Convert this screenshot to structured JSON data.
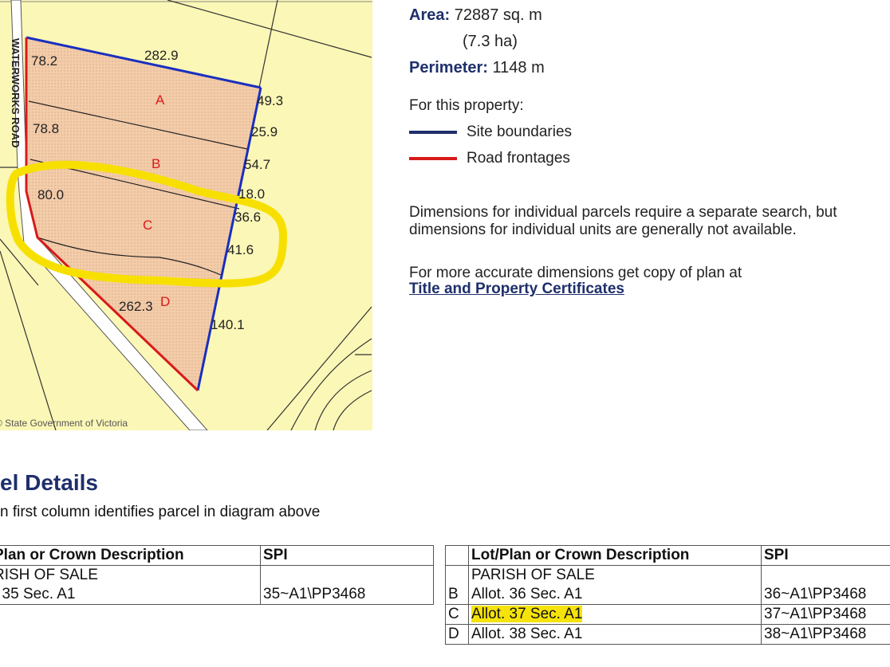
{
  "map": {
    "road_label": "WATERWORKS ROAD",
    "copyright": "© State Government of Victoria",
    "parcel_labels": [
      "A",
      "B",
      "C",
      "D"
    ],
    "dimensions": [
      "282.9",
      "78.2",
      "78.8",
      "80.0",
      "49.3",
      "25.9",
      "54.7",
      "18.0",
      "36.6",
      "41.6",
      "262.3",
      "140.1"
    ],
    "colors": {
      "site_boundary": "#1a2fbf",
      "road_frontage": "#d81a1a",
      "highlight": "#f7e000"
    }
  },
  "info": {
    "area_label": "Area:",
    "area_value": "72887 sq. m",
    "area_ha": "(7.3 ha)",
    "perimeter_label": "Perimeter:",
    "perimeter_value": "1148 m",
    "legend_title": "For this property:",
    "legend_site": "Site boundaries",
    "legend_road": "Road frontages",
    "note1_line1": "Dimensions for individual parcels require a separate search, but",
    "note1_line2": "dimensions for individual units are generally not available.",
    "note2": "For more accurate dimensions get copy of plan at",
    "link": "Title and Property Certificates"
  },
  "details": {
    "title": "el Details",
    "subtitle": "n first column identifies parcel in diagram above",
    "table_left": {
      "headers": [
        "Plan or Crown Description",
        "SPI"
      ],
      "rows": [
        {
          "desc_1": "RISH OF SALE",
          "desc_2": ". 35 Sec. A1",
          "spi": "35~A1\\PP3468"
        }
      ]
    },
    "table_right": {
      "headers": [
        "",
        "Lot/Plan or Crown Description",
        "SPI"
      ],
      "rows": [
        {
          "id": "",
          "desc": "PARISH OF SALE",
          "spi": ""
        },
        {
          "id": "B",
          "desc": "Allot. 36 Sec. A1",
          "spi": "36~A1\\PP3468"
        },
        {
          "id": "C",
          "desc": "Allot. 37 Sec. A1",
          "spi": "37~A1\\PP3468"
        },
        {
          "id": "D",
          "desc": "Allot. 38 Sec. A1",
          "spi": "38~A1\\PP3468"
        }
      ]
    }
  }
}
